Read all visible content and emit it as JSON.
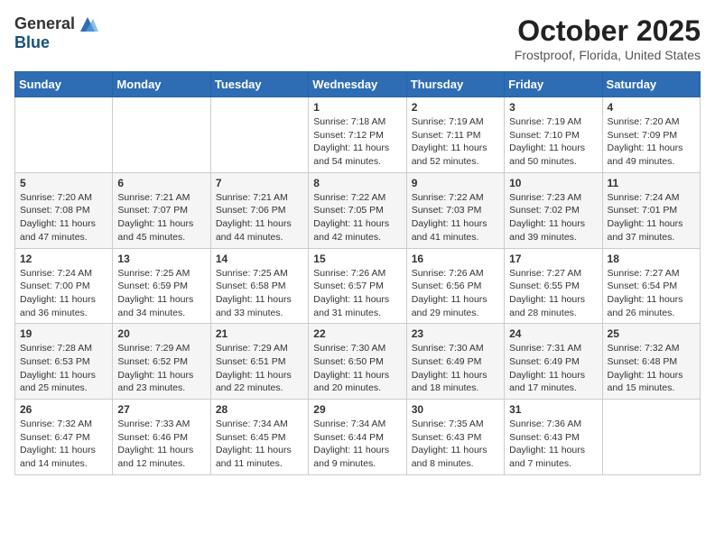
{
  "header": {
    "logo": {
      "general": "General",
      "blue": "Blue"
    },
    "title": "October 2025",
    "subtitle": "Frostproof, Florida, United States"
  },
  "weekdays": [
    "Sunday",
    "Monday",
    "Tuesday",
    "Wednesday",
    "Thursday",
    "Friday",
    "Saturday"
  ],
  "weeks": [
    [
      {
        "day": "",
        "content": ""
      },
      {
        "day": "",
        "content": ""
      },
      {
        "day": "",
        "content": ""
      },
      {
        "day": "1",
        "content": "Sunrise: 7:18 AM\nSunset: 7:12 PM\nDaylight: 11 hours\nand 54 minutes."
      },
      {
        "day": "2",
        "content": "Sunrise: 7:19 AM\nSunset: 7:11 PM\nDaylight: 11 hours\nand 52 minutes."
      },
      {
        "day": "3",
        "content": "Sunrise: 7:19 AM\nSunset: 7:10 PM\nDaylight: 11 hours\nand 50 minutes."
      },
      {
        "day": "4",
        "content": "Sunrise: 7:20 AM\nSunset: 7:09 PM\nDaylight: 11 hours\nand 49 minutes."
      }
    ],
    [
      {
        "day": "5",
        "content": "Sunrise: 7:20 AM\nSunset: 7:08 PM\nDaylight: 11 hours\nand 47 minutes."
      },
      {
        "day": "6",
        "content": "Sunrise: 7:21 AM\nSunset: 7:07 PM\nDaylight: 11 hours\nand 45 minutes."
      },
      {
        "day": "7",
        "content": "Sunrise: 7:21 AM\nSunset: 7:06 PM\nDaylight: 11 hours\nand 44 minutes."
      },
      {
        "day": "8",
        "content": "Sunrise: 7:22 AM\nSunset: 7:05 PM\nDaylight: 11 hours\nand 42 minutes."
      },
      {
        "day": "9",
        "content": "Sunrise: 7:22 AM\nSunset: 7:03 PM\nDaylight: 11 hours\nand 41 minutes."
      },
      {
        "day": "10",
        "content": "Sunrise: 7:23 AM\nSunset: 7:02 PM\nDaylight: 11 hours\nand 39 minutes."
      },
      {
        "day": "11",
        "content": "Sunrise: 7:24 AM\nSunset: 7:01 PM\nDaylight: 11 hours\nand 37 minutes."
      }
    ],
    [
      {
        "day": "12",
        "content": "Sunrise: 7:24 AM\nSunset: 7:00 PM\nDaylight: 11 hours\nand 36 minutes."
      },
      {
        "day": "13",
        "content": "Sunrise: 7:25 AM\nSunset: 6:59 PM\nDaylight: 11 hours\nand 34 minutes."
      },
      {
        "day": "14",
        "content": "Sunrise: 7:25 AM\nSunset: 6:58 PM\nDaylight: 11 hours\nand 33 minutes."
      },
      {
        "day": "15",
        "content": "Sunrise: 7:26 AM\nSunset: 6:57 PM\nDaylight: 11 hours\nand 31 minutes."
      },
      {
        "day": "16",
        "content": "Sunrise: 7:26 AM\nSunset: 6:56 PM\nDaylight: 11 hours\nand 29 minutes."
      },
      {
        "day": "17",
        "content": "Sunrise: 7:27 AM\nSunset: 6:55 PM\nDaylight: 11 hours\nand 28 minutes."
      },
      {
        "day": "18",
        "content": "Sunrise: 7:27 AM\nSunset: 6:54 PM\nDaylight: 11 hours\nand 26 minutes."
      }
    ],
    [
      {
        "day": "19",
        "content": "Sunrise: 7:28 AM\nSunset: 6:53 PM\nDaylight: 11 hours\nand 25 minutes."
      },
      {
        "day": "20",
        "content": "Sunrise: 7:29 AM\nSunset: 6:52 PM\nDaylight: 11 hours\nand 23 minutes."
      },
      {
        "day": "21",
        "content": "Sunrise: 7:29 AM\nSunset: 6:51 PM\nDaylight: 11 hours\nand 22 minutes."
      },
      {
        "day": "22",
        "content": "Sunrise: 7:30 AM\nSunset: 6:50 PM\nDaylight: 11 hours\nand 20 minutes."
      },
      {
        "day": "23",
        "content": "Sunrise: 7:30 AM\nSunset: 6:49 PM\nDaylight: 11 hours\nand 18 minutes."
      },
      {
        "day": "24",
        "content": "Sunrise: 7:31 AM\nSunset: 6:49 PM\nDaylight: 11 hours\nand 17 minutes."
      },
      {
        "day": "25",
        "content": "Sunrise: 7:32 AM\nSunset: 6:48 PM\nDaylight: 11 hours\nand 15 minutes."
      }
    ],
    [
      {
        "day": "26",
        "content": "Sunrise: 7:32 AM\nSunset: 6:47 PM\nDaylight: 11 hours\nand 14 minutes."
      },
      {
        "day": "27",
        "content": "Sunrise: 7:33 AM\nSunset: 6:46 PM\nDaylight: 11 hours\nand 12 minutes."
      },
      {
        "day": "28",
        "content": "Sunrise: 7:34 AM\nSunset: 6:45 PM\nDaylight: 11 hours\nand 11 minutes."
      },
      {
        "day": "29",
        "content": "Sunrise: 7:34 AM\nSunset: 6:44 PM\nDaylight: 11 hours\nand 9 minutes."
      },
      {
        "day": "30",
        "content": "Sunrise: 7:35 AM\nSunset: 6:43 PM\nDaylight: 11 hours\nand 8 minutes."
      },
      {
        "day": "31",
        "content": "Sunrise: 7:36 AM\nSunset: 6:43 PM\nDaylight: 11 hours\nand 7 minutes."
      },
      {
        "day": "",
        "content": ""
      }
    ]
  ]
}
